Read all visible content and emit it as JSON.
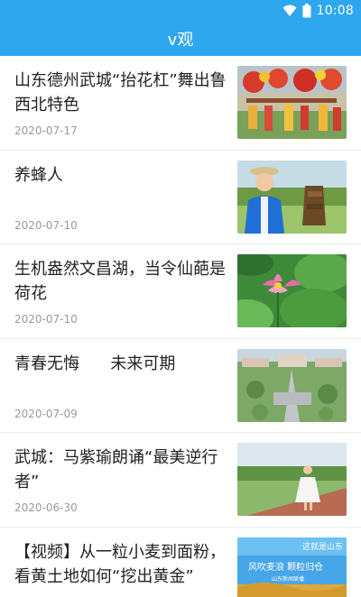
{
  "status_bar": {
    "time": "10:08",
    "icons": [
      "wifi-icon",
      "battery-icon"
    ],
    "color": "#2ea7ef"
  },
  "header": {
    "title": "v观"
  },
  "news": [
    {
      "title": "山东德州武城“抬花杠”舞出鲁西北特色",
      "date": "2020-07-17",
      "thumbnail": "folk-dance-photo"
    },
    {
      "title": "养蜂人",
      "date": "2020-07-10",
      "thumbnail": "beekeeper-photo"
    },
    {
      "title": "生机盎然文昌湖，当令仙葩是荷花",
      "date": "2020-07-10",
      "thumbnail": "lotus-photo"
    },
    {
      "title": "青春无悔      未来可期",
      "date": "2020-07-09",
      "thumbnail": "campus-aerial-photo"
    },
    {
      "title": "武城：马紫瑜朗诵“最美逆行者”",
      "date": "2020-06-30",
      "thumbnail": "girl-on-path-photo"
    },
    {
      "title": "【视频】从一粒小麦到面粉，看黄土地如何“挖出黄金”",
      "date": "",
      "thumbnail": "wheat-field-poster",
      "thumbnail_text": [
        "这就是山东",
        "风吹麦浪 颗粒归仓",
        "山东新闻联播"
      ]
    }
  ]
}
